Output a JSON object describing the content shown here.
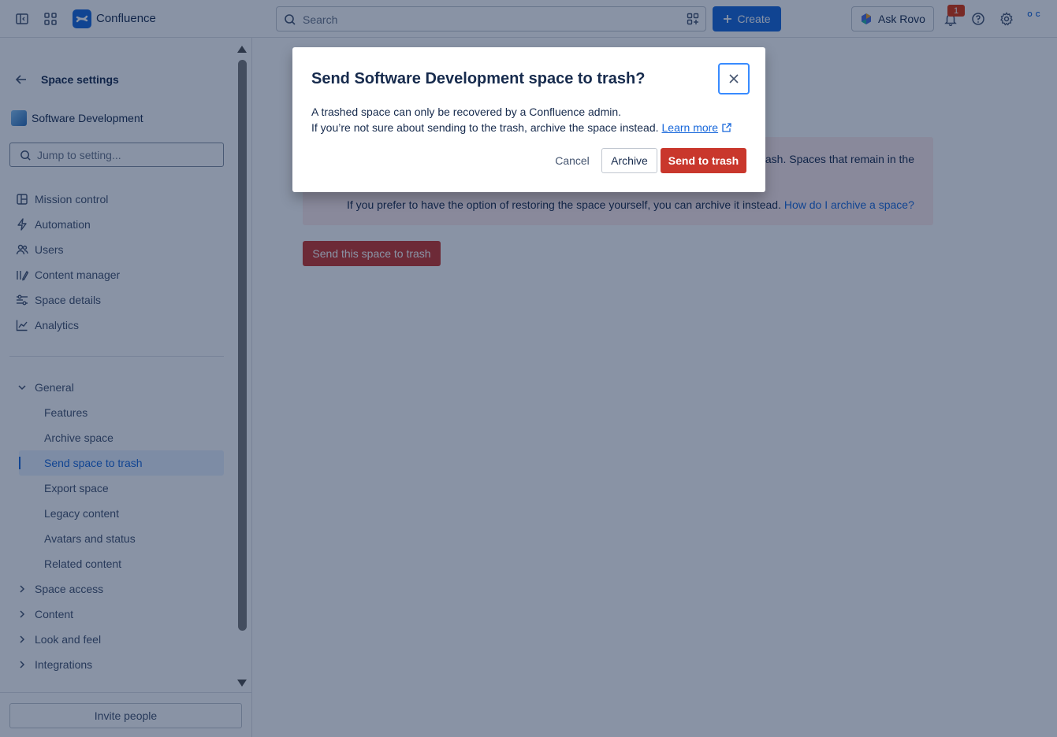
{
  "topbar": {
    "brand": "Confluence",
    "search_placeholder": "Search",
    "create_label": "Create",
    "rovo_label": "Ask Rovo",
    "notification_count": "1",
    "avatar_text": "O C"
  },
  "sidebar": {
    "header": "Space settings",
    "space_name": "Software Development",
    "jump_placeholder": "Jump to setting...",
    "nav": [
      {
        "label": "Mission control",
        "icon": "grid-icon"
      },
      {
        "label": "Automation",
        "icon": "lightning-icon"
      },
      {
        "label": "Users",
        "icon": "users-icon"
      },
      {
        "label": "Content manager",
        "icon": "pencil-icon"
      },
      {
        "label": "Space details",
        "icon": "sliders-icon"
      },
      {
        "label": "Analytics",
        "icon": "chart-icon"
      }
    ],
    "general": {
      "label": "General",
      "items": [
        "Features",
        "Archive space",
        "Send space to trash",
        "Export space",
        "Legacy content",
        "Avatars and status",
        "Related content"
      ],
      "active": "Send space to trash"
    },
    "sections": [
      "Space access",
      "Content",
      "Look and feel",
      "Integrations"
    ],
    "invite_label": "Invite people"
  },
  "main": {
    "warning_line1_visible": "rash. Spaces that remain in the",
    "warning_line2": "If you prefer to have the option of restoring the space yourself, you can archive it instead.",
    "warning_link": "How do I archive a space?",
    "trash_button": "Send this space to trash"
  },
  "modal": {
    "title": "Send Software Development space to trash?",
    "body_line1": "A trashed space can only be recovered by a Confluence admin.",
    "body_line2": "If you’re not sure about sending to the trash, archive the space instead.",
    "learn_more": "Learn more",
    "cancel_label": "Cancel",
    "archive_label": "Archive",
    "confirm_label": "Send to trash"
  },
  "colors": {
    "brand_blue": "#1868db",
    "danger_red": "#c9372c",
    "overlay": "rgba(9,30,66,0.48)"
  }
}
